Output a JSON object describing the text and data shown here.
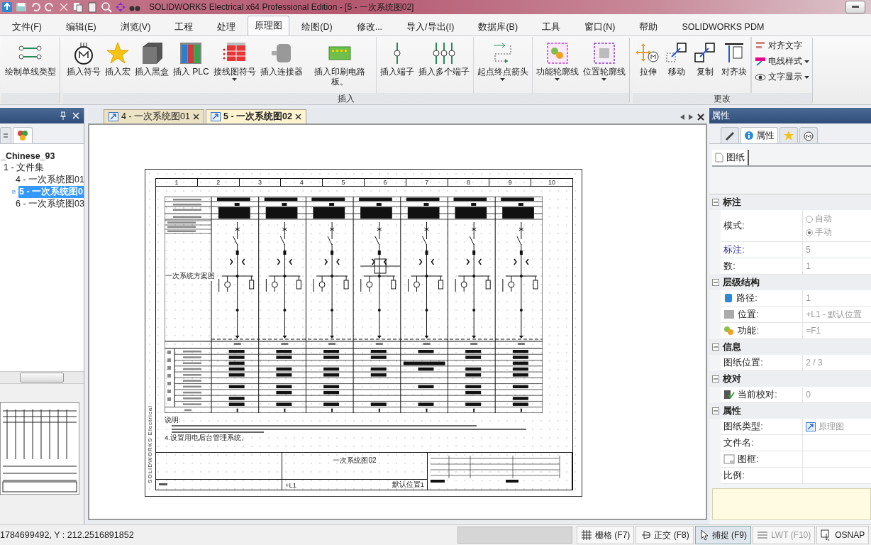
{
  "window": {
    "title": "SOLIDWORKS Electrical x64 Professional Edition - [5 - 一次系统图02]"
  },
  "menu_tabs": [
    {
      "label": "文件(F)",
      "selected": false
    },
    {
      "label": "编辑(E)",
      "selected": false
    },
    {
      "label": "浏览(V)",
      "selected": false
    },
    {
      "label": "工程",
      "selected": false
    },
    {
      "label": "处理",
      "selected": false
    },
    {
      "label": "原理图",
      "selected": true
    },
    {
      "label": "绘图(D)",
      "selected": false
    },
    {
      "label": "修改...",
      "selected": false
    },
    {
      "label": "导入/导出(I)",
      "selected": false
    },
    {
      "label": "数据库(B)",
      "selected": false
    },
    {
      "label": "工具",
      "selected": false
    },
    {
      "label": "窗口(N)",
      "selected": false
    },
    {
      "label": "帮助",
      "selected": false
    },
    {
      "label": "SOLIDWORKS PDM",
      "selected": false
    }
  ],
  "ribbon": {
    "groups": [
      {
        "sections": [
          [
            {
              "label": "绘制单线类型",
              "dropdown": false
            }
          ]
        ]
      },
      {
        "label": "插入",
        "sections": [
          [
            {
              "label": "插入符号",
              "dropdown": false
            },
            {
              "label": "插入宏",
              "dropdown": false
            },
            {
              "label": "插入黑盒",
              "dropdown": false
            },
            {
              "label": "插入 PLC",
              "dropdown": false
            },
            {
              "label": "接线图符号",
              "dropdown": true
            },
            {
              "label": "插入连接器",
              "dropdown": false
            },
            {
              "label": "插入印刷电路板。",
              "dropdown": false
            }
          ],
          [
            {
              "label": "插入端子",
              "dropdown": false
            },
            {
              "label": "插入多个端子",
              "dropdown": false
            }
          ],
          [
            {
              "label": "起点终点箭头",
              "dropdown": true
            }
          ],
          [
            {
              "label": "功能轮廓线",
              "dropdown": true
            },
            {
              "label": "位置轮廓线",
              "dropdown": true
            }
          ]
        ]
      },
      {
        "label": "更改",
        "sections": [
          [
            {
              "label": "拉伸",
              "dropdown": false
            },
            {
              "label": "移动",
              "dropdown": false
            },
            {
              "label": "复制",
              "dropdown": false
            },
            {
              "label": "对齐块",
              "dropdown": false
            }
          ]
        ],
        "small_buttons": [
          {
            "label": "对齐文字",
            "dropdown": false
          },
          {
            "label": "电线样式",
            "dropdown": true
          },
          {
            "label": "文字显示",
            "dropdown": true
          }
        ]
      }
    ]
  },
  "project_panel": {
    "tree": [
      {
        "label": "_Chinese_93",
        "selected": false,
        "children": [
          {
            "label": "1 - 文件集",
            "selected": false,
            "children": [
              {
                "label": "4 - 一次系统图01",
                "selected": false
              },
              {
                "label": "5 - 一次系统图0",
                "selected": true
              },
              {
                "label": "6 - 一次系统图03",
                "selected": false
              }
            ]
          }
        ]
      }
    ]
  },
  "document_tabs": [
    {
      "label": "4 - 一次系统图01",
      "selected": false
    },
    {
      "label": "5 - 一次系统图02",
      "selected": true
    }
  ],
  "drawing": {
    "columns": [
      "1",
      "2",
      "3",
      "4",
      "5",
      "6",
      "7",
      "8",
      "9",
      "10"
    ],
    "diagram_label": "一次系统方案图",
    "notes_heading": "说明:",
    "notes": [
      "4.设置用电后台管理系统。"
    ],
    "title": "一次系统图02",
    "location": "+L1",
    "location_name": "默认位置1",
    "side_label": "SOLIDWORKS Electrical"
  },
  "properties": {
    "title": "属性",
    "tabs": [
      {
        "selected": false
      },
      {
        "label": "属性",
        "selected": true
      },
      {
        "selected": false
      },
      {
        "selected": false
      }
    ],
    "sheet_tab": "图纸",
    "sections": [
      {
        "title": "标注",
        "expanded": true,
        "rows": [
          {
            "kind": "radio",
            "label": "模式:",
            "highlighted": false,
            "options": [
              {
                "label": "自动",
                "selected": false
              },
              {
                "label": "手动",
                "selected": true
              }
            ]
          },
          {
            "kind": "text",
            "label": "标注:",
            "highlighted": true,
            "value": "5"
          },
          {
            "kind": "text",
            "label": "数:",
            "highlighted": false,
            "value": "1"
          }
        ]
      },
      {
        "title": "层级结构",
        "expanded": true,
        "rows": [
          {
            "kind": "labelicon",
            "label": "路径:",
            "highlighted": false,
            "value": "1"
          },
          {
            "kind": "labelicon",
            "label": "位置:",
            "highlighted": false,
            "value": "+L1 - 默认位置"
          },
          {
            "kind": "labelicon",
            "label": "功能:",
            "highlighted": false,
            "value": "=F1"
          }
        ]
      },
      {
        "title": "信息",
        "expanded": true,
        "rows": [
          {
            "kind": "text",
            "label": "图纸位置:",
            "highlighted": false,
            "value": "2 / 3"
          }
        ]
      },
      {
        "title": "校对",
        "expanded": true,
        "rows": [
          {
            "kind": "labelicon",
            "label": "当前校对:",
            "highlighted": false,
            "value": "0"
          }
        ]
      },
      {
        "title": "属性",
        "expanded": true,
        "rows": [
          {
            "kind": "valueicon",
            "label": "图纸类型:",
            "highlighted": false,
            "value": "原理图"
          },
          {
            "kind": "text",
            "label": "文件名:",
            "highlighted": false
          },
          {
            "kind": "labelicon",
            "label": "图框:",
            "highlighted": false
          },
          {
            "kind": "text",
            "label": "比例:",
            "highlighted": false
          }
        ]
      }
    ]
  },
  "status_bar": {
    "coordinates": "1784699492, Y : 212.2516891852",
    "toggles": [
      {
        "label": "栅格 (F7)",
        "on": false,
        "disabled": false
      },
      {
        "label": "正交 (F8)",
        "on": false,
        "disabled": false
      },
      {
        "label": "捕捉 (F9)",
        "on": true,
        "disabled": false
      },
      {
        "label": "LWT (F10)",
        "on": false,
        "disabled": true
      },
      {
        "label": "OSNAP",
        "on": false,
        "disabled": false
      }
    ]
  }
}
